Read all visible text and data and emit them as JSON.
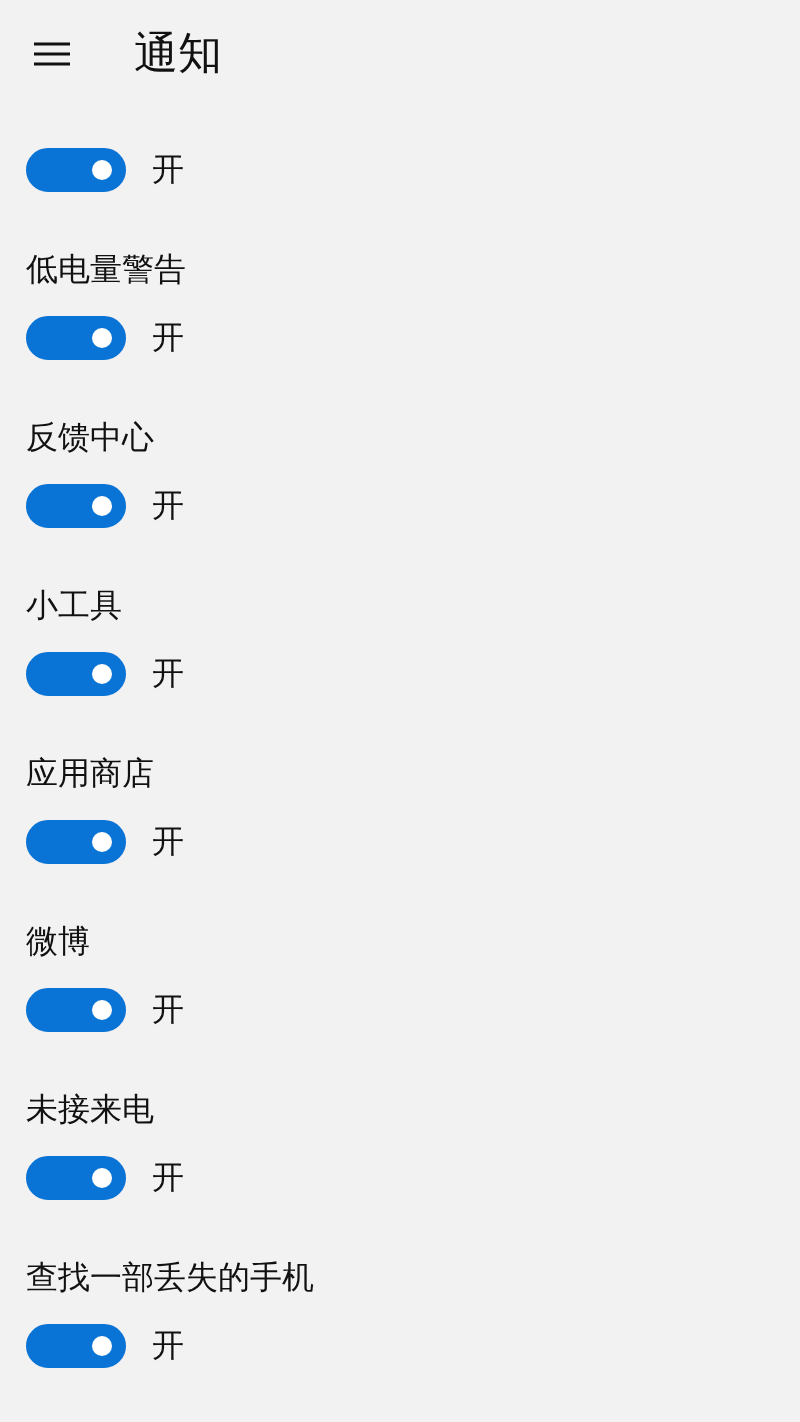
{
  "header": {
    "title": "通知"
  },
  "items": [
    {
      "on": true,
      "state_text": "开"
    },
    {
      "label": "低电量警告",
      "on": true,
      "state_text": "开"
    },
    {
      "label": "反馈中心",
      "on": true,
      "state_text": "开"
    },
    {
      "label": "小工具",
      "on": true,
      "state_text": "开"
    },
    {
      "label": "应用商店",
      "on": true,
      "state_text": "开"
    },
    {
      "label": "微博",
      "on": true,
      "state_text": "开"
    },
    {
      "label": "未接来电",
      "on": true,
      "state_text": "开"
    },
    {
      "label": "查找一部丢失的手机",
      "on": true,
      "state_text": "开"
    }
  ]
}
